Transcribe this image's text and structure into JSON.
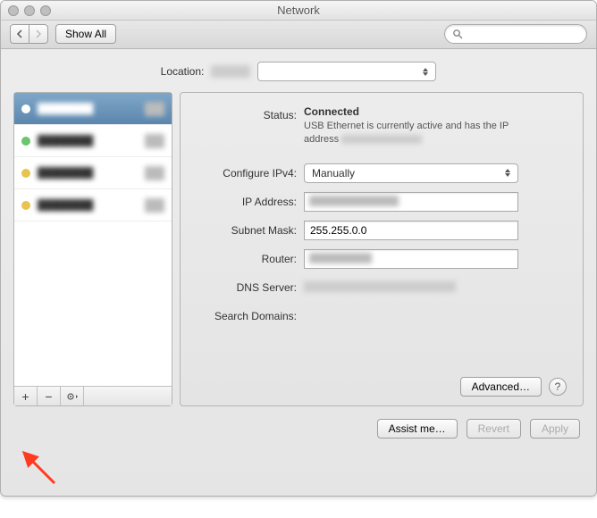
{
  "window": {
    "title": "Network"
  },
  "toolbar": {
    "show_all_label": "Show All",
    "search_placeholder": ""
  },
  "location": {
    "label": "Location:",
    "selected": ""
  },
  "sidebar": {
    "items": [
      {
        "status_color": "#ffffff"
      },
      {
        "status_color": "#6ac66a"
      },
      {
        "status_color": "#e8c34d"
      },
      {
        "status_color": "#e8c34d"
      }
    ],
    "footer": {
      "add": "+",
      "remove": "−",
      "menu": "✻▾"
    }
  },
  "status": {
    "label": "Status:",
    "value": "Connected",
    "desc_prefix": "USB Ethernet is currently active and has the IP address ",
    "desc_ip": ""
  },
  "fields": {
    "configure_label": "Configure IPv4:",
    "configure_value": "Manually",
    "ip_label": "IP Address:",
    "ip_value": "",
    "mask_label": "Subnet Mask:",
    "mask_value": "255.255.0.0",
    "router_label": "Router:",
    "router_value": "",
    "dns_label": "DNS Server:",
    "dns_value": "",
    "search_label": "Search Domains:",
    "search_value": ""
  },
  "buttons": {
    "advanced": "Advanced…",
    "help": "?",
    "assist": "Assist me…",
    "revert": "Revert",
    "apply": "Apply"
  }
}
